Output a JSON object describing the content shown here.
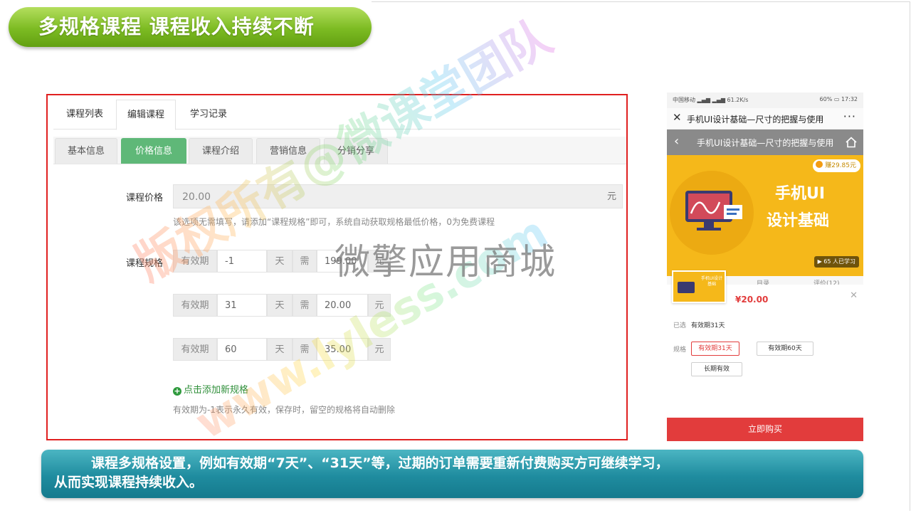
{
  "slide": {
    "title": "多规格课程  课程收入持续不断",
    "bottom_line1": "课程多规格设置，例如有效期“7天”、“31天”等，过期的订单需要重新付费购买方可继续学习，",
    "bottom_line2": "从而实现课程持续收入。"
  },
  "admin": {
    "main_tabs": [
      "课程列表",
      "编辑课程",
      "学习记录"
    ],
    "active_main_tab": "编辑课程",
    "sub_tabs": [
      "基本信息",
      "价格信息",
      "课程介绍",
      "营销信息",
      "分销分享"
    ],
    "active_sub_tab": "价格信息",
    "price": {
      "label": "课程价格",
      "value": "20.00",
      "unit": "元",
      "hint": "该选项无需填写，请添加“课程规格”即可，系统自动获取规格最低价格，0为免费课程"
    },
    "specs": {
      "label": "课程规格",
      "validity_label": "有效期",
      "day_unit": "天",
      "need_label": "需",
      "price_unit": "元",
      "rows": [
        {
          "days": "-1",
          "price": "199.00"
        },
        {
          "days": "31",
          "price": "20.00"
        },
        {
          "days": "60",
          "price": "35.00"
        }
      ],
      "add_link": "点击添加新规格",
      "footer_hint": "有效期为-1表示永久有效，保存时，留空的规格将自动删除"
    }
  },
  "phone": {
    "status_left": "中国移动 ▂▄▆ ▂▄▆ 61.2K/s",
    "status_right": "60% ▭ 17:32",
    "wx_title": "手机UI设计基础—尺寸的把握与使用",
    "page_title": "手机UI设计基础—尺寸的把握与使用",
    "earn_badge": "赚29.85元",
    "banner_line1": "手机UI",
    "banner_line2": "设计基础",
    "learn_badge": "▶ 65 人已学习",
    "thumb_text": "手机UI设计基础",
    "tab_catalog": "目录",
    "tab_review": "评价(12)",
    "price": "¥20.00",
    "selected_label": "已选",
    "selected_value": "有效期31天",
    "spec_label": "规格",
    "chips": [
      "有效期31天",
      "有效期60天",
      "长期有效"
    ],
    "active_chip": "有效期31天",
    "buy_button": "立即购买"
  },
  "watermarks": {
    "main": "微擎应用商城",
    "diag1": "版权所有@微课堂团队",
    "diag2": "www.lyless.com"
  },
  "colors": {
    "title_green": "#7cbb22",
    "tab_active_green": "#5fb878",
    "highlight_red": "#e02020",
    "buy_red": "#e23c3c",
    "banner_teal": "#1f8c9f",
    "course_yellow": "#f5b81a"
  }
}
